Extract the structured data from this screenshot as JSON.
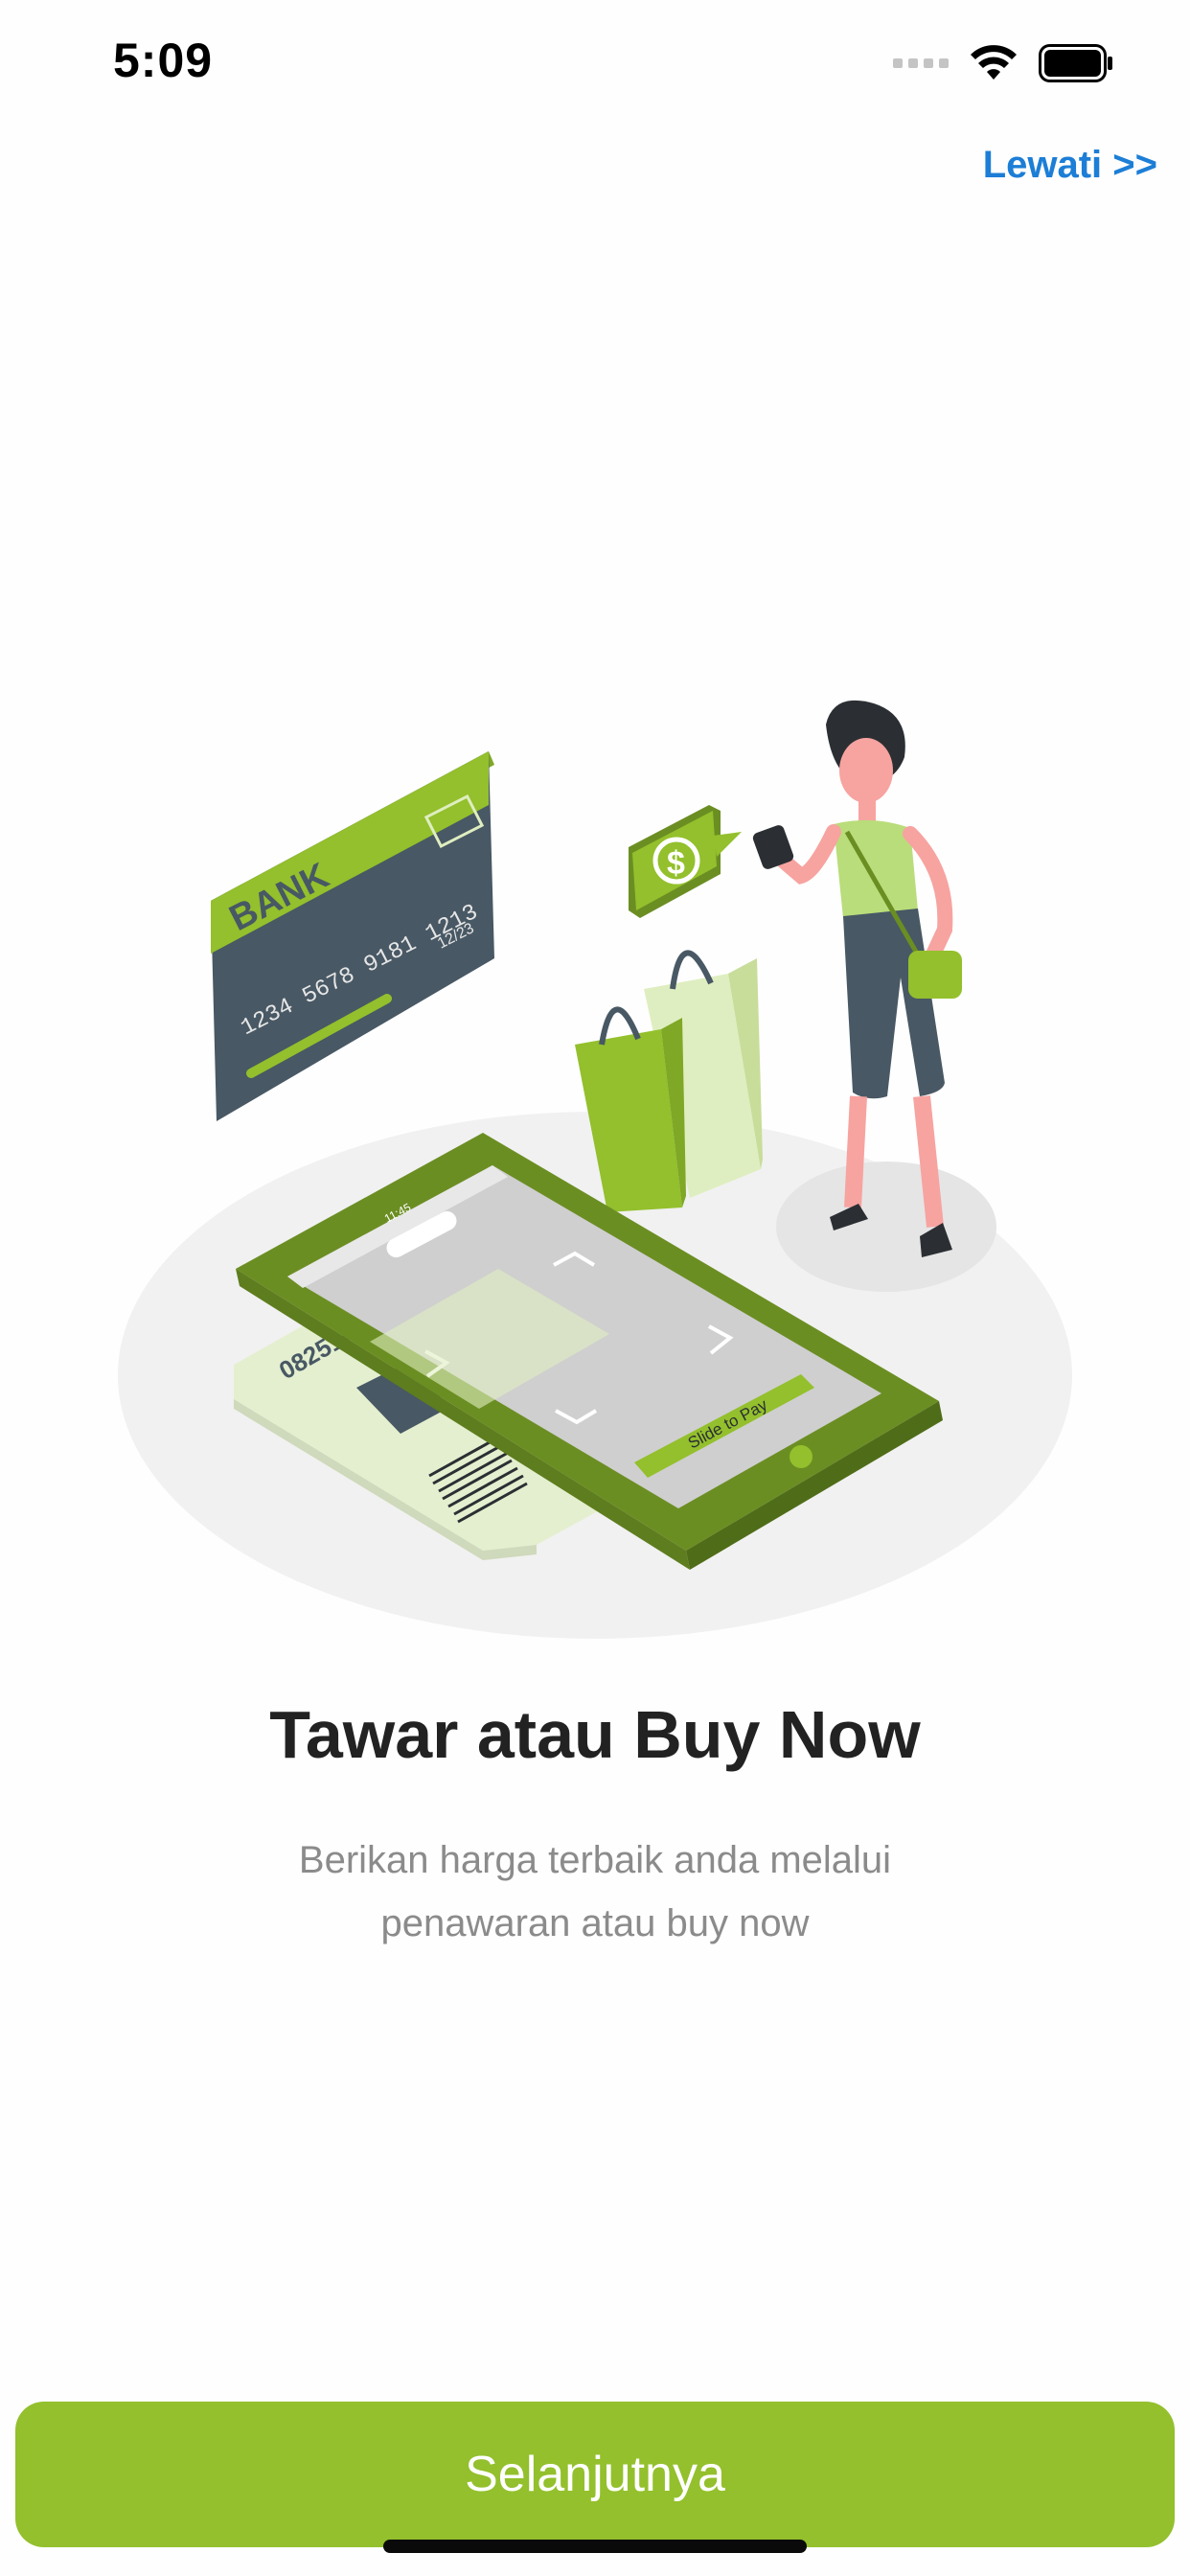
{
  "status_bar": {
    "time": "5:09"
  },
  "header": {
    "skip_label": "Lewati >>"
  },
  "illustration": {
    "card_bank_text": "BANK",
    "card_number": "1234 5678 9181 1213",
    "card_expiry": "12/23",
    "phone_time": "11:45",
    "slide_label": "Slide to Pay",
    "ticket_number": "082514",
    "coin_symbol": "$",
    "colors": {
      "brand_green": "#93c02c",
      "dark_green": "#6b8e23",
      "light_green": "#dfeec0",
      "slate": "#485864"
    }
  },
  "content": {
    "title": "Tawar atau Buy Now",
    "subtitle_line1": "Berikan harga terbaik anda melalui",
    "subtitle_line2": "penawaran atau buy now"
  },
  "footer": {
    "next_label": "Selanjutnya"
  },
  "colors": {
    "accent": "#93c02c",
    "link": "#1c7ed6",
    "title": "#222222",
    "subtitle": "#8b8b8b"
  }
}
